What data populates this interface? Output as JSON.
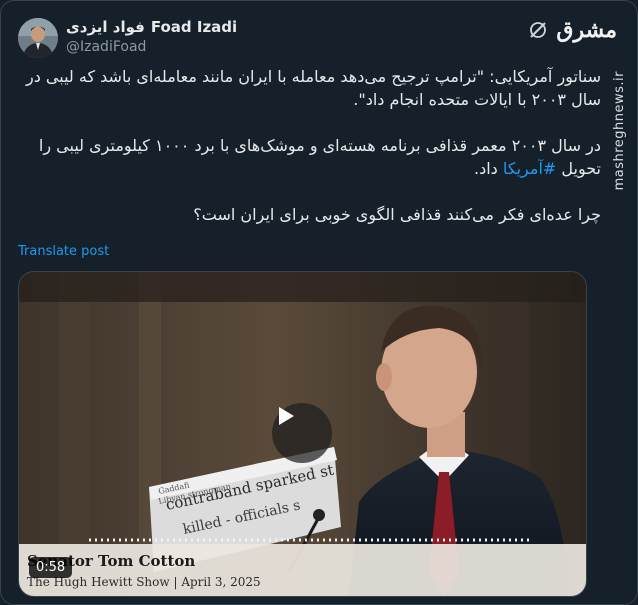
{
  "author": {
    "name": "Foad Izadi",
    "name_fa": "فواد ایزدی",
    "handle": "@IzadiFoad"
  },
  "brand": {
    "logo_text": "مشرق",
    "watermark": "mashreghnews.ir"
  },
  "tweet": {
    "paragraph_1": "سناتور آمریکایی: \"ترامپ ترجیح می‌دهد معامله با ایران مانند معامله‌ای باشد که لیبی در سال ۲۰۰۳ با ایالات متحده انجام داد\".",
    "paragraph_2_before": "در سال ۲۰۰۳ معمر قذافی برنامه هسته‌ای و موشک‌های با برد ۱۰۰۰ کیلومتری لیبی را تحویل ",
    "hashtag": "#آمریکا",
    "paragraph_2_after": " داد.",
    "paragraph_3": "چرا عده‌ای فکر می‌کنند قذافی الگوی خوبی برای ایران است؟"
  },
  "translate_label": "Translate post",
  "video": {
    "duration": "0:58",
    "caption_name": "Senator Tom Cotton",
    "caption_show": "The Hugh Hewitt Show | April 3, 2025",
    "headline_fragment": "contraband sparked st",
    "headline_fragment_2": "killed - officials s"
  },
  "colors": {
    "background": "#15202b",
    "text": "#e7e9ea",
    "secondary_text": "#8b98a5",
    "link": "#1d9bf0"
  }
}
